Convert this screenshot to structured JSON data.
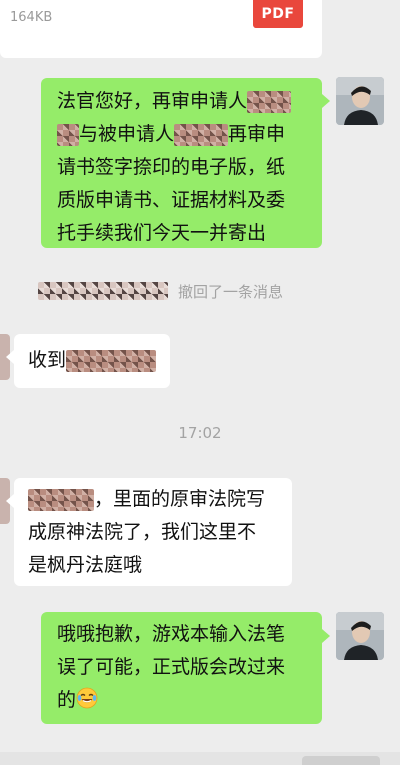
{
  "file_card": {
    "size": "164KB",
    "icon_label": "PDF"
  },
  "messages": [
    {
      "lines": [
        "法官您好，再审申请人",
        "与被申请人",
        "再审申",
        "请书签字捺印的电子版，纸",
        "质版申请书、证据材料及委",
        "托手续我们今天一并寄出"
      ]
    },
    {
      "recall_text": "撤回了一条消息"
    },
    {
      "text": "收到"
    },
    {
      "time": "17:02"
    },
    {
      "lines": [
        "，里面的原审法院写",
        "成原神法院了，我们这里不",
        "是枫丹法庭哦"
      ]
    },
    {
      "lines": [
        "哦哦抱歉，游戏本输入法笔",
        "误了可能，正式版会改过来",
        "的"
      ]
    }
  ],
  "colors": {
    "outgoing": "#95ec69",
    "incoming": "#ffffff",
    "background": "#ededed",
    "pdf": "#e9473c"
  },
  "icons": {
    "file": "pdf-file-icon",
    "emoji": "tears-of-joy-emoji-icon"
  }
}
